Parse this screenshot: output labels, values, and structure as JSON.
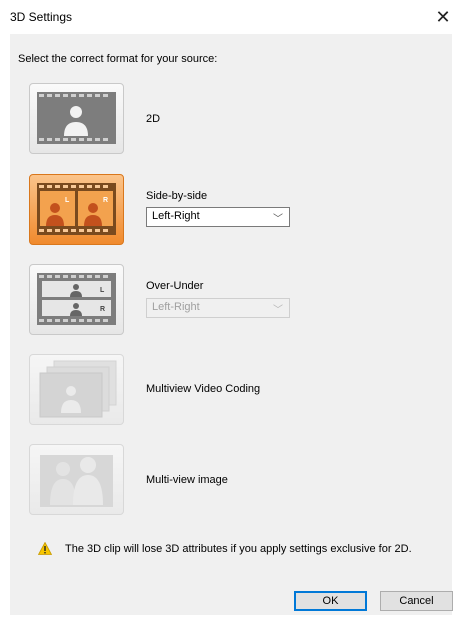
{
  "window": {
    "title": "3D Settings",
    "close_icon": "close-icon"
  },
  "prompt": "Select the correct format for your source:",
  "options": [
    {
      "id": "2d",
      "label": "2D",
      "icon": "single-person-film-icon"
    },
    {
      "id": "sbs",
      "label": "Side-by-side",
      "icon": "side-by-side-film-icon",
      "selected": true,
      "select": {
        "value": "Left-Right",
        "enabled": true
      }
    },
    {
      "id": "ou",
      "label": "Over-Under",
      "icon": "over-under-film-icon",
      "select": {
        "value": "Left-Right",
        "enabled": false
      }
    },
    {
      "id": "mvc",
      "label": "Multiview Video Coding",
      "icon": "multiview-video-icon",
      "enabled": false
    },
    {
      "id": "mvi",
      "label": "Multi-view image",
      "icon": "multiview-image-icon",
      "enabled": false
    }
  ],
  "thumb_letters": {
    "left": "L",
    "right": "R"
  },
  "warning": {
    "icon": "warning-icon",
    "text": "The 3D clip will lose 3D attributes if you apply settings exclusive for 2D."
  },
  "buttons": {
    "ok": "OK",
    "cancel": "Cancel"
  },
  "colors": {
    "selected_orange": "#f08a2d",
    "accent_blue": "#0078d7",
    "panel_bg": "#f0f0f0"
  }
}
